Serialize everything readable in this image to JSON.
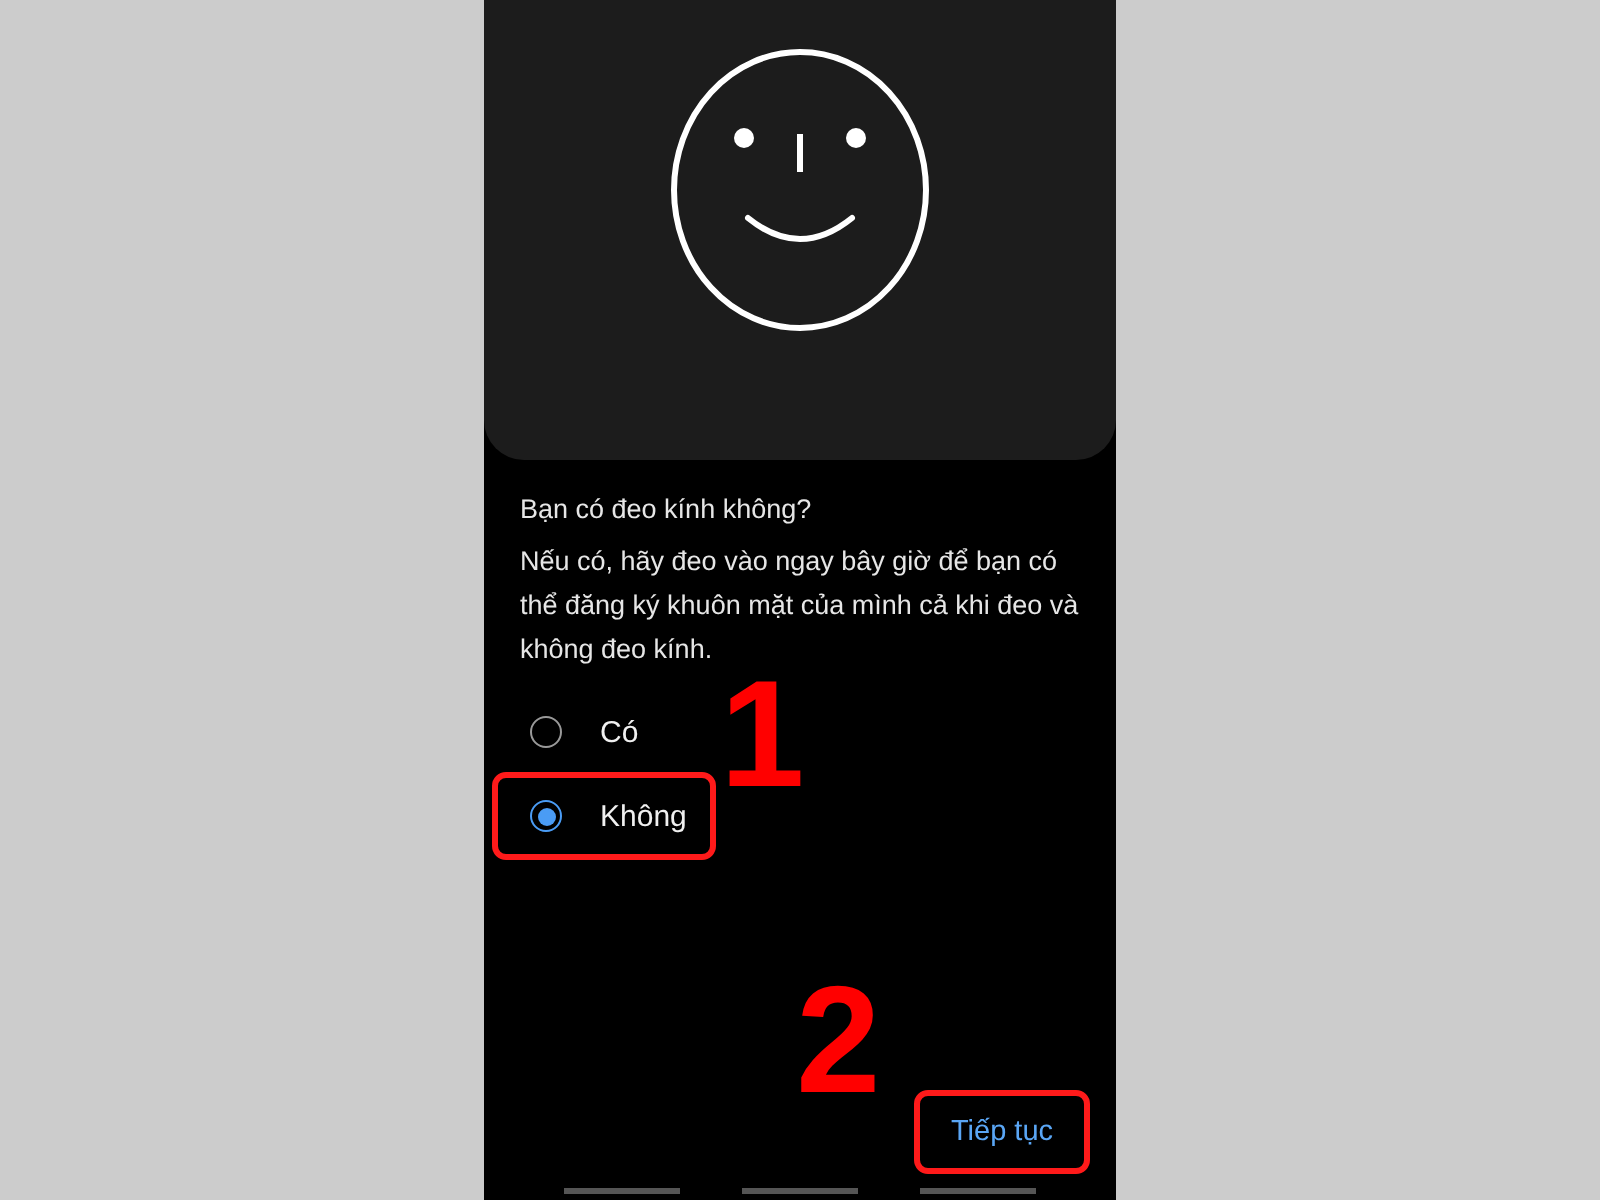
{
  "question": "Bạn có đeo kính không?",
  "description": "Nếu có, hãy đeo vào ngay bây giờ để bạn có thể đăng ký khuôn mặt của mình cả khi đeo và không đeo kính.",
  "options": [
    {
      "label": "Có",
      "selected": false,
      "highlighted": false
    },
    {
      "label": "Không",
      "selected": true,
      "highlighted": true,
      "callout": "1"
    }
  ],
  "continue_button": {
    "label": "Tiếp tục",
    "highlighted": true,
    "callout": "2"
  }
}
